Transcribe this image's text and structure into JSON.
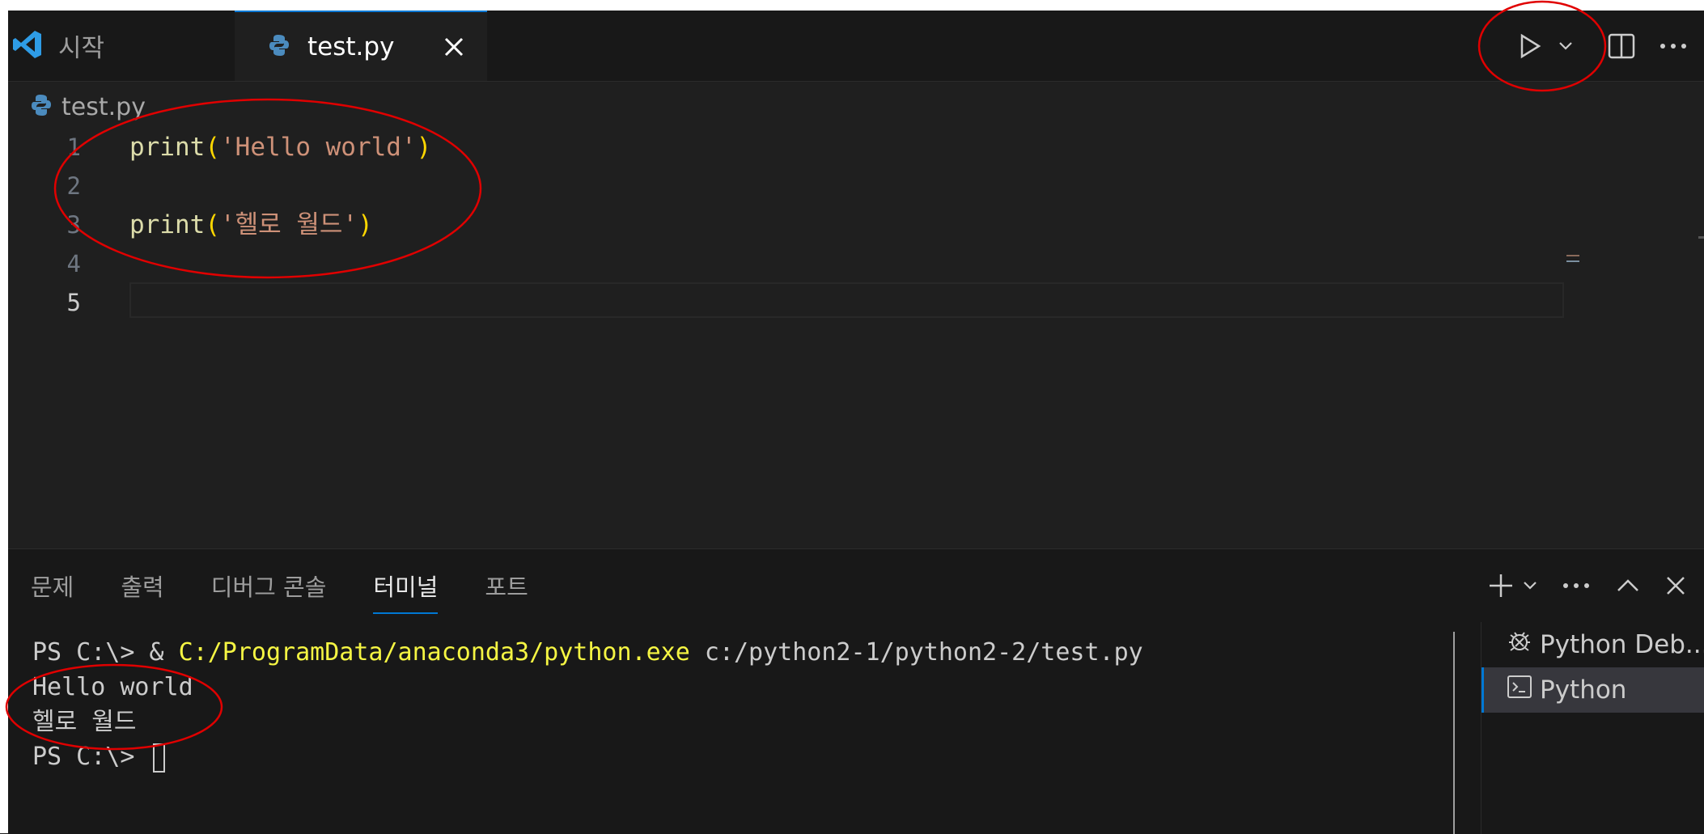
{
  "tabs": [
    {
      "label": "시작",
      "icon": "vscode-logo-icon",
      "active": false
    },
    {
      "label": "test.py",
      "icon": "python-file-icon",
      "active": true
    }
  ],
  "toolbar": {
    "run_icon": "play-icon",
    "run_dropdown_icon": "chevron-down-icon",
    "split_icon": "split-editor-icon",
    "more_icon": "more-actions-icon"
  },
  "breadcrumb": {
    "file": "test.py"
  },
  "editor": {
    "lines": [
      {
        "number": "1",
        "fn": "print",
        "open": "(",
        "str": "'Hello world'",
        "close": ")"
      },
      {
        "number": "2"
      },
      {
        "number": "3",
        "fn": "print",
        "open": "(",
        "str": "'헬로 월드'",
        "close": ")"
      },
      {
        "number": "4"
      },
      {
        "number": "5"
      }
    ],
    "active_line": "5"
  },
  "panel": {
    "tabs": [
      "문제",
      "출력",
      "디버그 콘솔",
      "터미널",
      "포트"
    ],
    "active_tab": "터미널",
    "actions": [
      "add-icon",
      "chevron-down-icon",
      "more-actions-icon",
      "chevron-up-icon",
      "close-icon"
    ]
  },
  "terminal": {
    "cmd_prompt": "PS C:\\> & ",
    "cmd_exe": "C:/ProgramData/anaconda3/python.exe",
    "cmd_arg": " c:/python2-1/python2-2/test.py",
    "output1": "Hello world",
    "output2": "헬로 월드",
    "prompt": "PS C:\\> "
  },
  "terminal_list": [
    {
      "label": "Python Deb...",
      "icon": "debug-icon",
      "selected": false
    },
    {
      "label": "Python",
      "icon": "terminal-icon",
      "selected": true
    }
  ],
  "colors": {
    "accent": "#0078d4",
    "annotation": "#e00000",
    "string": "#ce9178",
    "function": "#dcdcaa",
    "bracket": "#ffd700"
  }
}
